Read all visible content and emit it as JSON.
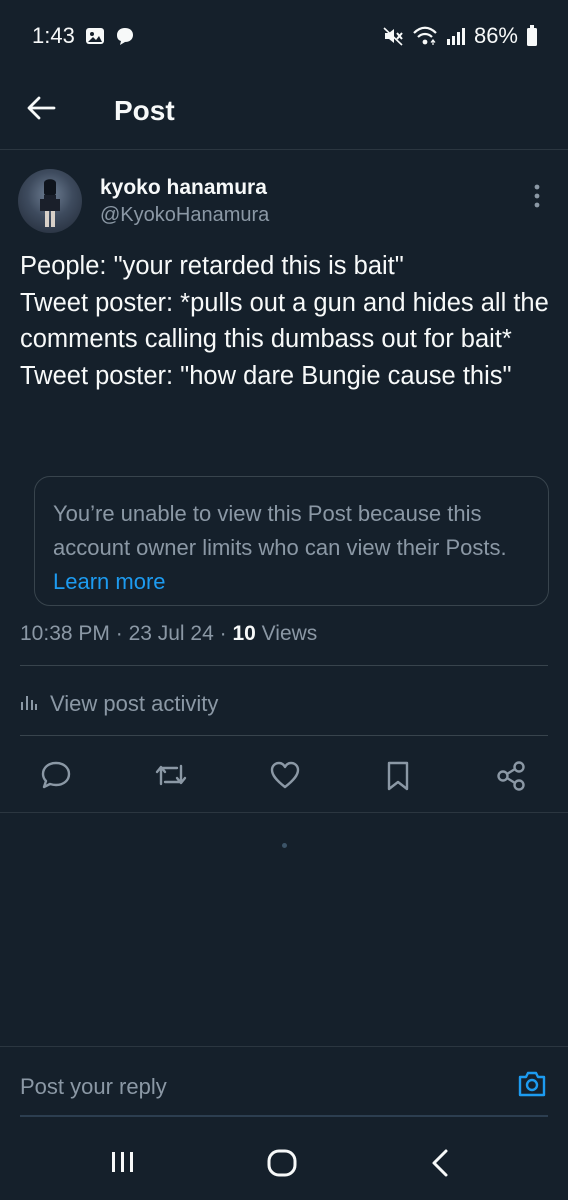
{
  "status_bar": {
    "time": "1:43",
    "battery": "86%",
    "icons": [
      "gallery-icon",
      "chat-bubble-icon",
      "mute-icon",
      "wifi-icon",
      "signal-icon",
      "battery-icon"
    ]
  },
  "header": {
    "title": "Post"
  },
  "post": {
    "author": {
      "display_name": "kyoko hanamura",
      "handle": "@KyokoHanamura"
    },
    "text": "People: \"your retarded this is bait\"\nTweet poster: *pulls out a gun and hides all the comments calling this dumbass out for bait*\nTweet poster: \"how dare Bungie cause this\"",
    "quoted_notice": {
      "text": "You’re unable to view this Post because this account owner limits who can view their Posts. ",
      "link": "Learn more"
    },
    "meta": {
      "time": "10:38 PM",
      "separator": " · ",
      "date": "23 Jul 24",
      "views_count": "10",
      "views_label": " Views"
    },
    "activity_label": "View post activity",
    "actions": [
      "reply-icon",
      "repost-icon",
      "like-icon",
      "bookmark-icon",
      "share-icon"
    ]
  },
  "reply": {
    "placeholder": "Post your reply"
  },
  "colors": {
    "background": "#15202b",
    "accent": "#1d9bf0",
    "muted": "#8b98a5",
    "text": "#f7f9f9",
    "border": "#38444d"
  }
}
